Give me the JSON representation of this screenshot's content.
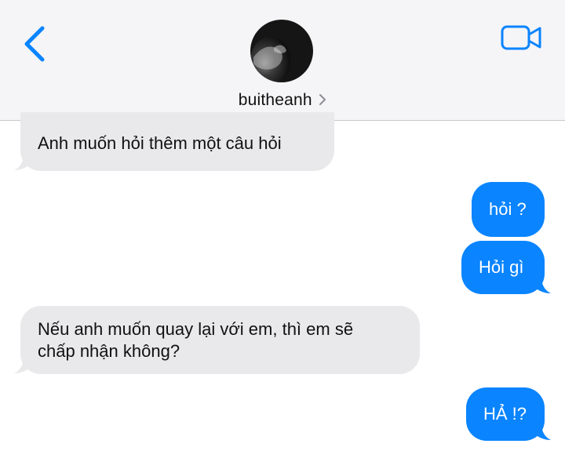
{
  "header": {
    "contact_name": "buitheanh",
    "icons": {
      "back": "chevron-left-icon",
      "video": "video-camera-icon",
      "details": "chevron-right-icon"
    }
  },
  "messages": [
    {
      "direction": "received",
      "lines": [
        "Anh muốn hỏi thêm một câu hỏi"
      ]
    },
    {
      "direction": "sent",
      "lines": [
        "hỏi ?"
      ]
    },
    {
      "direction": "sent",
      "lines": [
        "Hỏi gì"
      ]
    },
    {
      "direction": "received",
      "lines": [
        "Nếu anh muốn quay lại với em, thì em sẽ",
        "chấp nhận không?"
      ]
    },
    {
      "direction": "sent",
      "lines": [
        "HẢ !?"
      ]
    }
  ],
  "colors": {
    "accent": "#0a84ff",
    "received_bubble": "#e9e9eb",
    "header_bg": "#f5f5f7"
  }
}
